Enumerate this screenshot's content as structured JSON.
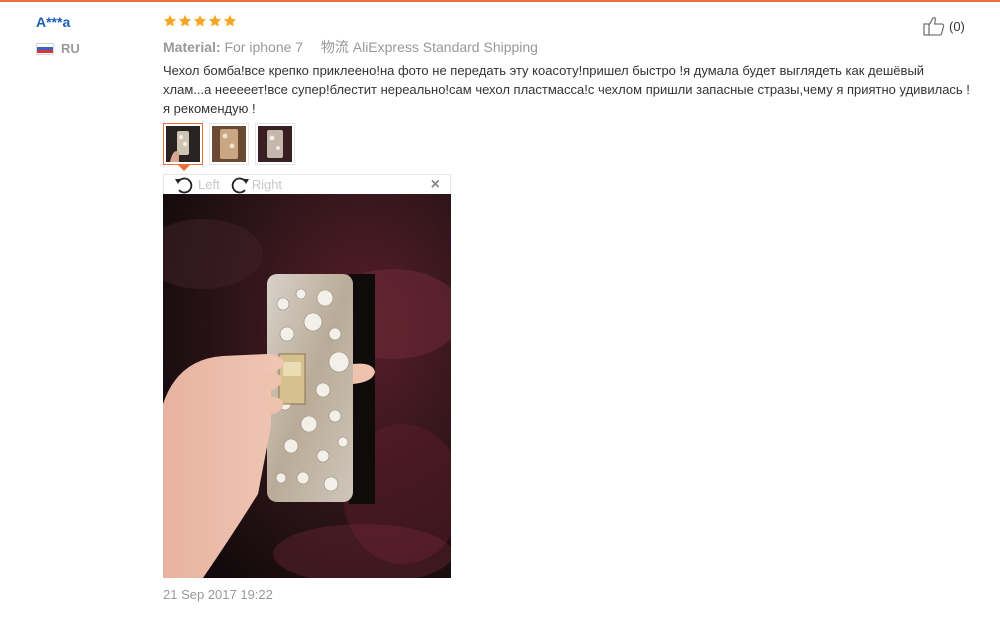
{
  "review": {
    "user_name": "A***a",
    "country_code": "RU",
    "rating": 5,
    "helpful_count": "(0)",
    "material_label": "Material:",
    "material_value": "For iphone 7",
    "shipping_label": "物流",
    "shipping_value": "AliExpress Standard Shipping",
    "text": "Чехол бомба!все крепко приклеено!на фото не передать эту коасоту!пришел быстро !я думала будет выглядеть как дешёвый хлам...а нееееет!все супер!блестит нереально!сам чехол пластмасса!с чехлом пришли запасные стразы,чему я приятно удивилась !я рекомендую !",
    "date": "21 Sep 2017 19:22"
  },
  "viewer": {
    "rotate_left_label": "Left",
    "rotate_right_label": "Right",
    "close_label": "×"
  },
  "colors": {
    "accent": "#e8703a",
    "username": "#1a5fb4",
    "star": "#f5a623",
    "muted": "#999999"
  },
  "icons": {
    "helpful": "thumbs-up-icon",
    "rotate_left": "rotate-left-icon",
    "rotate_right": "rotate-right-icon",
    "close": "close-icon",
    "flag": "russia-flag-icon",
    "star": "star-icon"
  }
}
